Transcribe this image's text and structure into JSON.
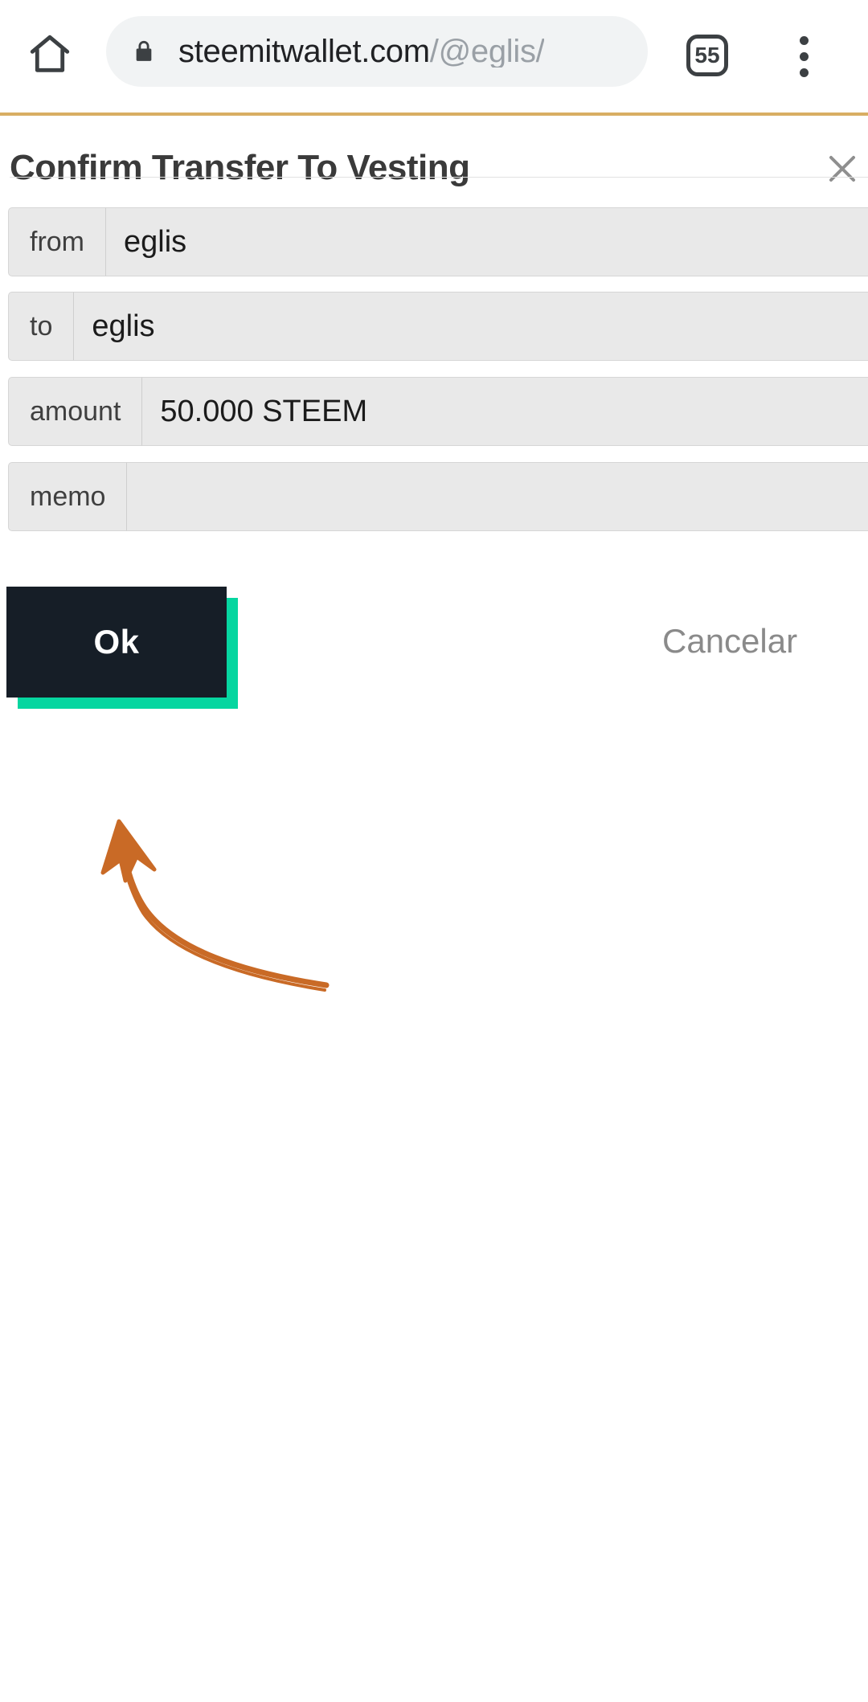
{
  "browser": {
    "home_icon": "home-icon",
    "lock_icon": "lock-icon",
    "url_domain": "steemitwallet.com",
    "url_path": "/@eglis/",
    "url_full": "steemitwallet.com/@eglis/",
    "tab_count": "55",
    "menu_icon": "overflow-menu-icon"
  },
  "dialog": {
    "title": "Confirm Transfer To Vesting",
    "close_icon": "close-icon",
    "rows": [
      {
        "label": "from",
        "value": "eglis"
      },
      {
        "label": "to",
        "value": "eglis"
      },
      {
        "label": "amount",
        "value": "50.000 STEEM"
      },
      {
        "label": "memo",
        "value": ""
      }
    ],
    "ok_label": "Ok",
    "cancel_label": "Cancelar"
  },
  "colors": {
    "accent_green": "#06d6a0",
    "button_dark": "#161e27",
    "progress_line": "#d8ae63",
    "annotation_orange": "#c96a26",
    "field_gray": "#e9e9e9",
    "url_path_gray": "#9aa0a6"
  },
  "annotation": {
    "shape": "hand-drawn-arrow",
    "points_to": "ok-button"
  }
}
